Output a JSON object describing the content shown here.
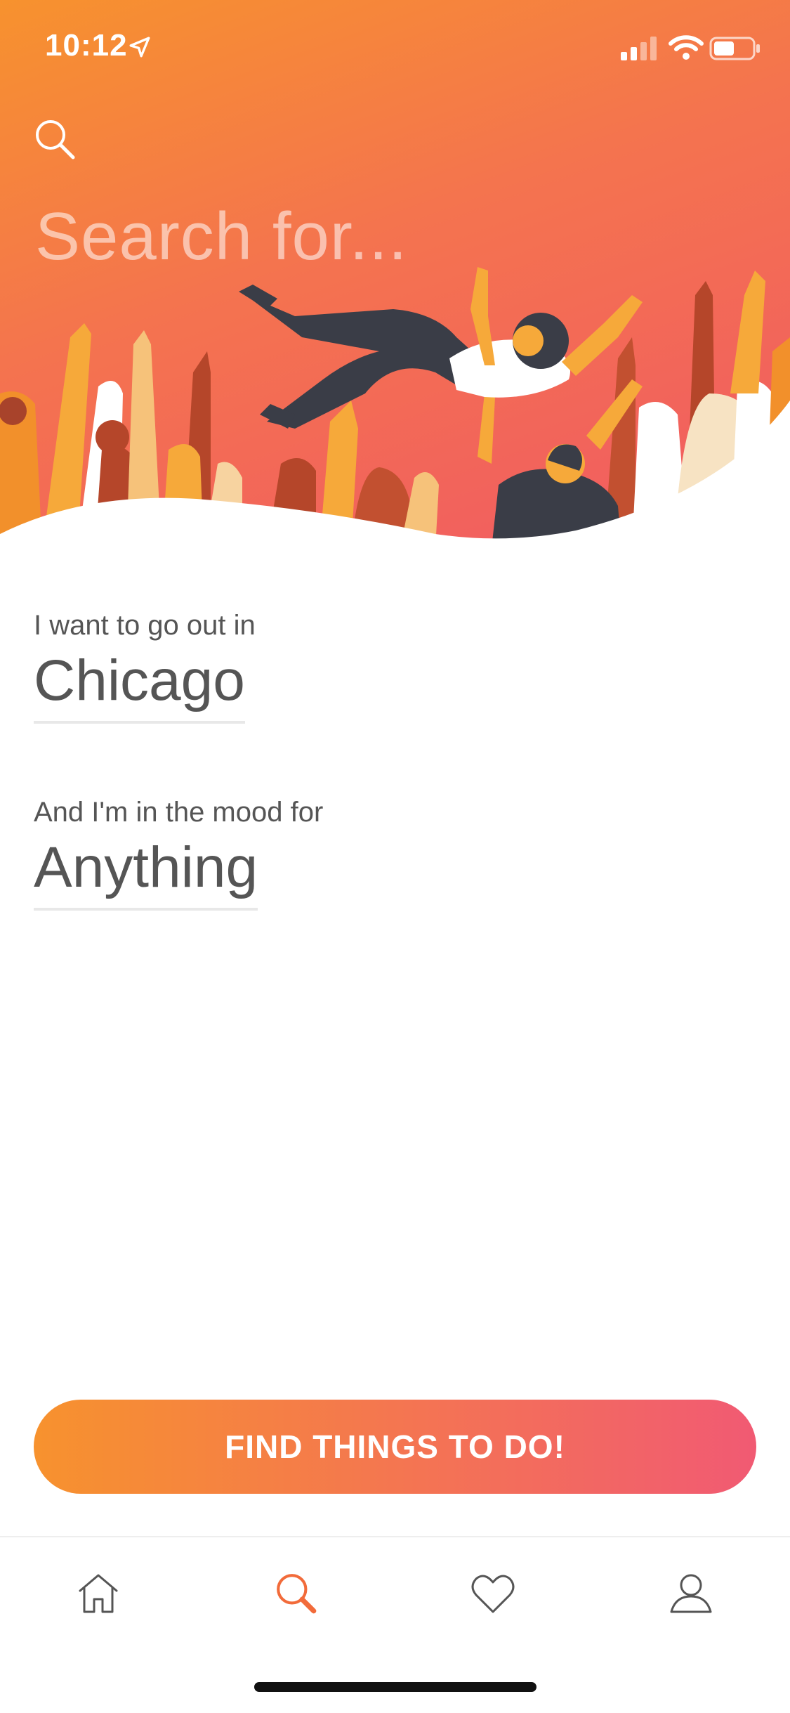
{
  "status_bar": {
    "time": "10:12"
  },
  "search": {
    "placeholder": "Search for..."
  },
  "location": {
    "label": "I want to go out in",
    "value": "Chicago"
  },
  "mood": {
    "label": "And I'm in the mood for",
    "value": "Anything"
  },
  "cta": {
    "label": "FIND THINGS TO DO!"
  },
  "tabbar": {
    "items": [
      {
        "icon": "home-icon",
        "active": false
      },
      {
        "icon": "search-icon",
        "active": true
      },
      {
        "icon": "heart-icon",
        "active": false
      },
      {
        "icon": "profile-icon",
        "active": false
      }
    ],
    "active_color": "#f26b3a",
    "inactive_color": "#555555"
  },
  "colors": {
    "gradient_start": "#f7922e",
    "gradient_end": "#f15a73",
    "text": "#555555"
  }
}
